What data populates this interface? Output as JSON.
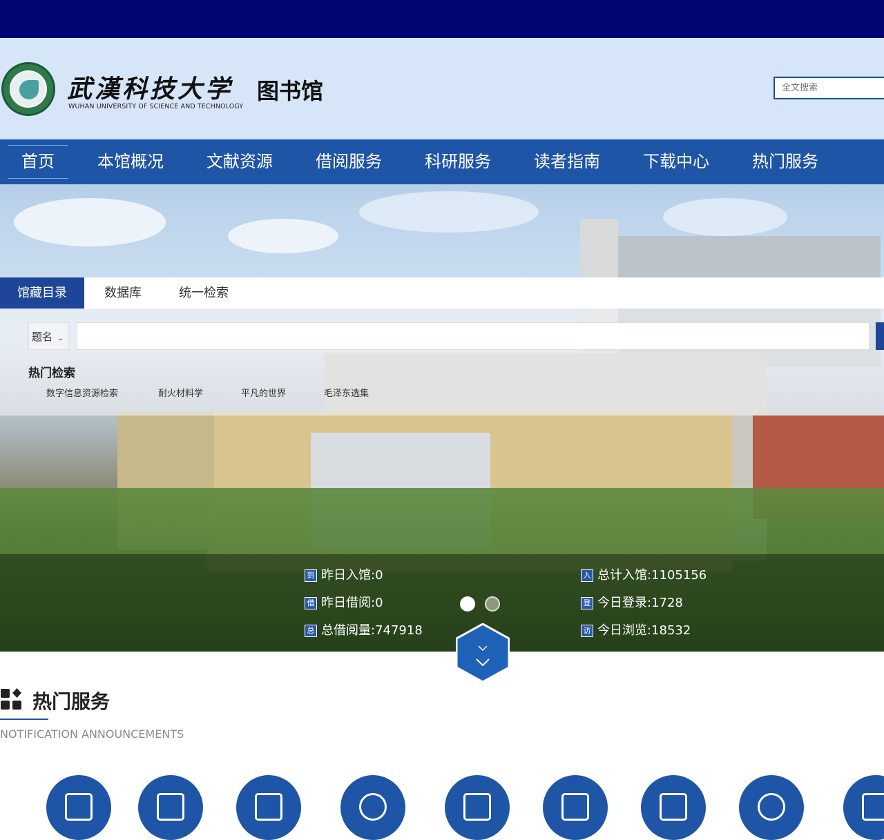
{
  "header": {
    "logo_cn": "武漢科技大学",
    "logo_en": "WUHAN UNIVERSITY OF SCIENCE AND TECHNOLOGY",
    "library": "图书馆",
    "search_placeholder": "全文搜索"
  },
  "nav": {
    "items": [
      "首页",
      "本馆概况",
      "文献资源",
      "借阅服务",
      "科研服务",
      "读者指南",
      "下载中心",
      "热门服务"
    ]
  },
  "search": {
    "tabs": [
      "馆藏目录",
      "数据库",
      "统一检索"
    ],
    "field": "题名",
    "hot_title": "热门检索",
    "hot_keywords": [
      "数字信息资源检索",
      "耐火材料学",
      "平凡的世界",
      "毛泽东选集"
    ]
  },
  "stats": {
    "yesterday_visits": {
      "icon": "到",
      "label": "昨日入馆",
      "value": "0"
    },
    "yesterday_borrow": {
      "icon": "借",
      "label": "昨日借阅",
      "value": "0"
    },
    "total_borrow": {
      "icon": "总",
      "label": "总借阅量",
      "value": "747918"
    },
    "total_visits": {
      "icon": "入",
      "label": "总计入馆",
      "value": "1105156"
    },
    "today_login": {
      "icon": "登",
      "label": "今日登录",
      "value": "1728"
    },
    "today_browse": {
      "icon": "访",
      "label": "今日浏览",
      "value": "18532"
    }
  },
  "section": {
    "title": "热门服务",
    "subtitle": "NOTIFICATION ANNOUNCEMENTS"
  },
  "colors": {
    "topbar": "#020574",
    "nav": "#1e55a6",
    "accent": "#1e4597",
    "header_bg": "#d6e6f8"
  },
  "icons": [
    "seal-logo",
    "search-icon",
    "chevron-down-icon",
    "hexagon-scroll-icon",
    "grid-icon"
  ]
}
